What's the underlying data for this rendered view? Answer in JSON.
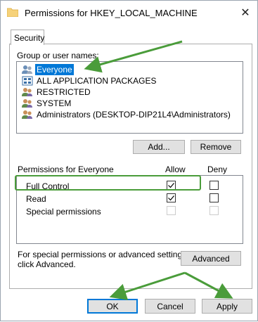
{
  "window": {
    "title": "Permissions for HKEY_LOCAL_MACHINE",
    "close_symbol": "✕"
  },
  "tab": {
    "label": "Security"
  },
  "group_label": "Group or user names:",
  "users": [
    {
      "name": "Everyone",
      "icon": "user-group-icon",
      "selected": true
    },
    {
      "name": "ALL APPLICATION PACKAGES",
      "icon": "app-packages-icon",
      "selected": false
    },
    {
      "name": "RESTRICTED",
      "icon": "user-group-icon",
      "selected": false
    },
    {
      "name": "SYSTEM",
      "icon": "user-group-icon",
      "selected": false
    },
    {
      "name": "Administrators (DESKTOP-DIP21L4\\Administrators)",
      "icon": "user-group-icon",
      "selected": false
    }
  ],
  "buttons": {
    "add": "Add...",
    "remove": "Remove",
    "advanced": "Advanced",
    "ok": "OK",
    "cancel": "Cancel",
    "apply": "Apply"
  },
  "permissions": {
    "header": "Permissions for Everyone",
    "allow_header": "Allow",
    "deny_header": "Deny",
    "rows": [
      {
        "name": "Full Control",
        "allow": true,
        "deny": false,
        "disabled": false
      },
      {
        "name": "Read",
        "allow": true,
        "deny": false,
        "disabled": false
      },
      {
        "name": "Special permissions",
        "allow": false,
        "deny": false,
        "disabled": true
      }
    ]
  },
  "advanced_note": {
    "line1": "For special permissions or advanced settings,",
    "line2": "click Advanced."
  },
  "colors": {
    "selection": "#0078d7",
    "annotation_green": "#4a9c3a",
    "default_button_border": "#0078d7"
  }
}
